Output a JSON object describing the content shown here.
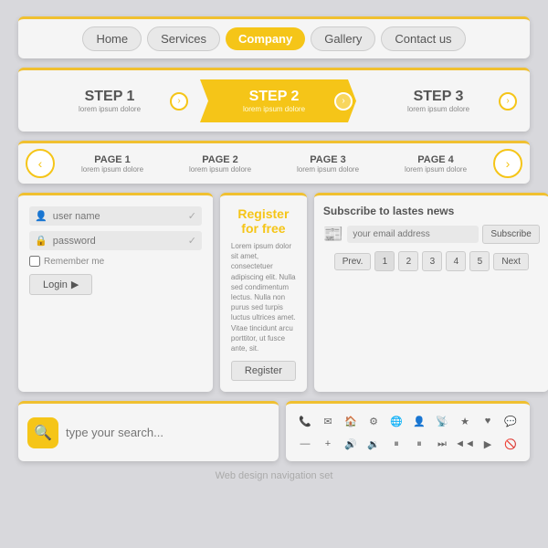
{
  "nav": {
    "items": [
      {
        "label": "Home",
        "active": false
      },
      {
        "label": "Services",
        "active": false
      },
      {
        "label": "Company",
        "active": true
      },
      {
        "label": "Gallery",
        "active": false
      },
      {
        "label": "Contact us",
        "active": false
      }
    ]
  },
  "steps": {
    "items": [
      {
        "label": "STEP 1",
        "sub": "lorem ipsum dolore",
        "active": false
      },
      {
        "label": "STEP 2",
        "sub": "lorem ipsum dolore",
        "active": true
      },
      {
        "label": "STEP 3",
        "sub": "lorem ipsum dolore",
        "active": false
      }
    ]
  },
  "pages": {
    "prev": "‹",
    "next": "›",
    "items": [
      {
        "label": "PAGE 1",
        "desc": "lorem ipsum dolore"
      },
      {
        "label": "PAGE 2",
        "desc": "lorem ipsum dolore"
      },
      {
        "label": "PAGE 3",
        "desc": "lorem ipsum dolore"
      },
      {
        "label": "PAGE 4",
        "desc": "lorem ipsum dolore"
      }
    ]
  },
  "login": {
    "username_placeholder": "user name",
    "password_placeholder": "password",
    "remember_label": "Remember me",
    "button_label": "Login"
  },
  "register": {
    "title": "Register for free",
    "text": "Lorem ipsum dolor sit amet, consectetuer adipiscing elit. Nulla sed condimentum lectus. Nulla non purus sed turpis luctus ultrices amet. Vitae tincidunt arcu porttitor, ut fusce ante, sit.",
    "button_label": "Register"
  },
  "subscribe": {
    "title": "Subscribe to lastes news",
    "placeholder": "your email address",
    "button_label": "Subscribe",
    "pagination": {
      "prev": "Prev.",
      "next": "Next",
      "pages": [
        "1",
        "2",
        "3",
        "4",
        "5"
      ]
    }
  },
  "search": {
    "placeholder": "type your search...",
    "icon": "🔍"
  },
  "icons": {
    "row1": [
      "📞",
      "✉",
      "🏠",
      "⚙",
      "🌐",
      "👤",
      "📡",
      "★",
      "♥",
      "💬"
    ],
    "row2": [
      "—",
      "+",
      "🔊",
      "🔉",
      "⏸",
      "⏸",
      "⏭",
      "◄",
      "▶",
      "🚫"
    ]
  },
  "footer": {
    "text": "Web design navigation set"
  }
}
